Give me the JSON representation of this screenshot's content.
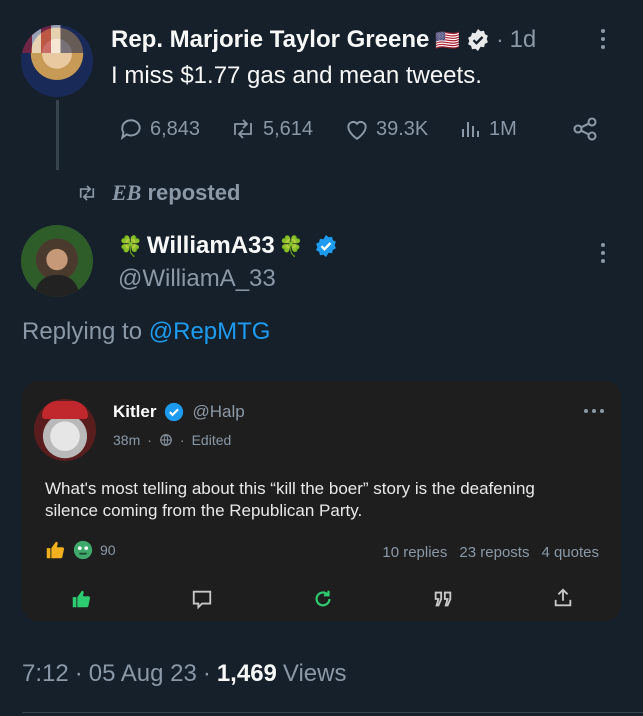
{
  "main_post": {
    "display_name": "Rep. Marjorie Taylor Greene",
    "flag": "🇺🇸",
    "time": "1d",
    "text": "I miss $1.77 gas and mean tweets.",
    "stats": {
      "replies": "6,843",
      "reposts": "5,614",
      "likes": "39.3K",
      "views": "1M"
    }
  },
  "repost_banner": {
    "user": "EB",
    "label": "reposted"
  },
  "reply_post": {
    "clover": "🍀",
    "display_name": "WilliamA33",
    "handle": "@WilliamA_33",
    "replying_prefix": "Replying to",
    "replying_to": "@RepMTG",
    "footer": {
      "time": "7:12",
      "date": "05 Aug 23",
      "views": "1,469",
      "views_label": "Views",
      "sep": "·"
    }
  },
  "embedded_card": {
    "author": "Kitler",
    "handle": "@Halp",
    "time": "38m",
    "edited": "Edited",
    "sep": "·",
    "text_line1": "What's most telling about this “kill the boer” story is the deafening",
    "text_line2": "silence coming from the Republican Party.",
    "reaction_count": "90",
    "replies": "10 replies",
    "reposts": "23 reposts",
    "quotes": "4 quotes",
    "colors": {
      "green": "#2ecc71",
      "blue": "#1d9bf0",
      "bg": "#1e1e1e"
    }
  }
}
